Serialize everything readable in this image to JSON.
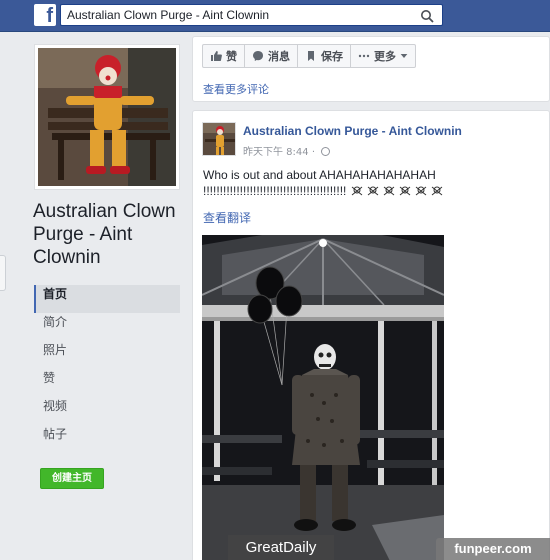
{
  "topbar": {
    "logo_letter": "f",
    "search_value": "Australian Clown Purge - Aint Clownin"
  },
  "page": {
    "name": "Australian Clown Purge - Aint Clownin"
  },
  "nav": {
    "items": [
      {
        "label": "首页",
        "active": true
      },
      {
        "label": "简介"
      },
      {
        "label": "照片"
      },
      {
        "label": "赞"
      },
      {
        "label": "视频"
      },
      {
        "label": "帖子"
      }
    ],
    "create_page_label": "创建主页"
  },
  "actions": {
    "like": "赞",
    "message": "消息",
    "save": "保存",
    "more": "更多"
  },
  "comments": {
    "more_label": "查看更多评论"
  },
  "post": {
    "author": "Australian Clown Purge - Aint Clownin",
    "time": "昨天下午 8:44 · ",
    "text_line1": "Who is out and about AHAHAHAHAHAHAH",
    "text_line2": "!!!!!!!!!!!!!!!!!!!!!!!!!!!!!!!!!!!!!!!!!!!",
    "see_translation": "查看翻译"
  },
  "watermarks": {
    "left": "GreatDaily",
    "right": "funpeer.com"
  },
  "colors": {
    "brand": "#3b5998",
    "link": "#4267b2",
    "create_button": "#42b72a"
  }
}
